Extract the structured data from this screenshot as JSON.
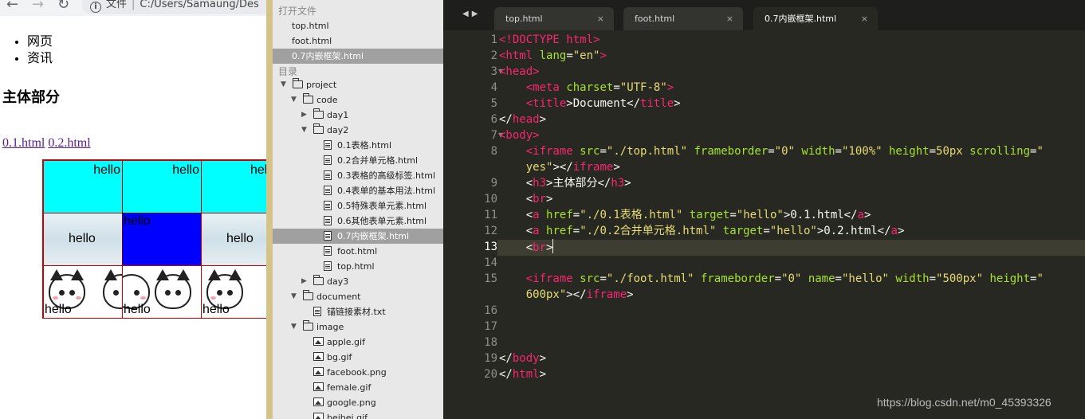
{
  "browser": {
    "url_label": "文件",
    "url_text": "C:/Users/Samaung/Des",
    "list_items": [
      "网页",
      "资讯"
    ],
    "heading": "主体部分",
    "links": [
      "0.1.html",
      "0.2.html"
    ],
    "cell_text": "hello"
  },
  "sidebar": {
    "open_files_header": "打开文件",
    "open_files": [
      "top.html",
      "foot.html",
      "0.7内嵌框架.html"
    ],
    "folders_header": "目录",
    "tree": [
      {
        "label": "project",
        "kind": "folder-open",
        "indent": 0
      },
      {
        "label": "code",
        "kind": "folder-open",
        "indent": 1
      },
      {
        "label": "day1",
        "kind": "folder",
        "indent": 2
      },
      {
        "label": "day2",
        "kind": "folder-open",
        "indent": 2
      },
      {
        "label": "0.1表格.html",
        "kind": "file",
        "indent": 3
      },
      {
        "label": "0.2合并单元格.html",
        "kind": "file",
        "indent": 3
      },
      {
        "label": "0.3表格的高级标签.html",
        "kind": "file",
        "indent": 3
      },
      {
        "label": "0.4表单的基本用法.html",
        "kind": "file",
        "indent": 3
      },
      {
        "label": "0.5特殊表单元素.html",
        "kind": "file",
        "indent": 3
      },
      {
        "label": "0.6其他表单元素.html",
        "kind": "file",
        "indent": 3
      },
      {
        "label": "0.7内嵌框架.html",
        "kind": "file",
        "indent": 3,
        "selected": true
      },
      {
        "label": "foot.html",
        "kind": "file",
        "indent": 3
      },
      {
        "label": "top.html",
        "kind": "file",
        "indent": 3
      },
      {
        "label": "day3",
        "kind": "folder",
        "indent": 2
      },
      {
        "label": "document",
        "kind": "folder-open",
        "indent": 1
      },
      {
        "label": "锚链接素材.txt",
        "kind": "file",
        "indent": 2
      },
      {
        "label": "image",
        "kind": "folder-open",
        "indent": 1
      },
      {
        "label": "apple.gif",
        "kind": "image",
        "indent": 2
      },
      {
        "label": "bg.gif",
        "kind": "image",
        "indent": 2
      },
      {
        "label": "facebook.png",
        "kind": "image",
        "indent": 2
      },
      {
        "label": "female.gif",
        "kind": "image",
        "indent": 2
      },
      {
        "label": "google.png",
        "kind": "image",
        "indent": 2
      },
      {
        "label": "beibei.gif",
        "kind": "image",
        "indent": 2
      }
    ]
  },
  "editor": {
    "tabs": [
      {
        "label": "top.html",
        "active": false
      },
      {
        "label": "foot.html",
        "active": false
      },
      {
        "label": "0.7内嵌框架.html",
        "active": true
      }
    ],
    "line_numbers": [
      "1",
      "2",
      "3",
      "4",
      "5",
      "6",
      "7",
      "8",
      "",
      "9",
      "10",
      "11",
      "12",
      "13",
      "14",
      "15",
      "",
      "16",
      "17",
      "18",
      "19",
      "20"
    ],
    "current_line": "13",
    "code": [
      [
        [
          "t",
          "<!DOCTYPE html>"
        ]
      ],
      [
        [
          "t",
          "<html"
        ],
        [
          "w",
          " "
        ],
        [
          "a",
          "lang"
        ],
        [
          "w",
          "="
        ],
        [
          "s",
          "\"en\""
        ],
        [
          "t",
          ">"
        ]
      ],
      [
        [
          "t",
          "<head>"
        ]
      ],
      [
        [
          "w",
          "    "
        ],
        [
          "t",
          "<meta"
        ],
        [
          "w",
          " "
        ],
        [
          "a",
          "charset"
        ],
        [
          "w",
          "="
        ],
        [
          "s",
          "\"UTF-8\""
        ],
        [
          "t",
          ">"
        ]
      ],
      [
        [
          "w",
          "    "
        ],
        [
          "t",
          "<title"
        ],
        [
          "w",
          ">Document</"
        ],
        [
          "t",
          "title"
        ],
        [
          "w",
          ">"
        ]
      ],
      [
        [
          "w",
          "</"
        ],
        [
          "t",
          "head"
        ],
        [
          "w",
          ">"
        ]
      ],
      [
        [
          "t",
          "<body>"
        ]
      ],
      [
        [
          "w",
          "    "
        ],
        [
          "t",
          "<iframe"
        ],
        [
          "w",
          " "
        ],
        [
          "a",
          "src"
        ],
        [
          "w",
          "="
        ],
        [
          "s",
          "\"./top.html\""
        ],
        [
          "w",
          " "
        ],
        [
          "a",
          "frameborder"
        ],
        [
          "w",
          "="
        ],
        [
          "s",
          "\"0\""
        ],
        [
          "w",
          " "
        ],
        [
          "a",
          "width"
        ],
        [
          "w",
          "="
        ],
        [
          "s",
          "\"100%\""
        ],
        [
          "w",
          " "
        ],
        [
          "a",
          "height"
        ],
        [
          "w",
          "="
        ],
        [
          "s",
          "50px"
        ],
        [
          "w",
          " "
        ],
        [
          "a",
          "scrolling"
        ],
        [
          "w",
          "="
        ],
        [
          "s",
          "\""
        ]
      ],
      [
        [
          "s",
          "    yes\""
        ],
        [
          "w",
          "></"
        ],
        [
          "t",
          "iframe"
        ],
        [
          "w",
          ">"
        ]
      ],
      [
        [
          "w",
          "    <"
        ],
        [
          "t",
          "h3"
        ],
        [
          "w",
          ">主体部分</"
        ],
        [
          "t",
          "h3"
        ],
        [
          "w",
          ">"
        ]
      ],
      [
        [
          "w",
          "    <"
        ],
        [
          "t",
          "br"
        ],
        [
          "w",
          ">"
        ]
      ],
      [
        [
          "w",
          "    <"
        ],
        [
          "t",
          "a"
        ],
        [
          "w",
          " "
        ],
        [
          "a",
          "href"
        ],
        [
          "w",
          "="
        ],
        [
          "s",
          "\"./0.1表格.html\""
        ],
        [
          "w",
          " "
        ],
        [
          "a",
          "target"
        ],
        [
          "w",
          "="
        ],
        [
          "s",
          "\"hello\""
        ],
        [
          "w",
          ">0.1.html</"
        ],
        [
          "t",
          "a"
        ],
        [
          "w",
          ">"
        ]
      ],
      [
        [
          "w",
          "    <"
        ],
        [
          "t",
          "a"
        ],
        [
          "w",
          " "
        ],
        [
          "a",
          "href"
        ],
        [
          "w",
          "="
        ],
        [
          "s",
          "\"./0.2合并单元格.html\""
        ],
        [
          "w",
          " "
        ],
        [
          "a",
          "target"
        ],
        [
          "w",
          "="
        ],
        [
          "s",
          "\"hello\""
        ],
        [
          "w",
          ">0.2.html</"
        ],
        [
          "t",
          "a"
        ],
        [
          "w",
          ">"
        ]
      ],
      [
        [
          "w",
          "    <"
        ],
        [
          "t",
          "br"
        ],
        [
          "w",
          ">"
        ]
      ],
      [],
      [
        [
          "w",
          "    "
        ],
        [
          "t",
          "<iframe"
        ],
        [
          "w",
          " "
        ],
        [
          "a",
          "src"
        ],
        [
          "w",
          "="
        ],
        [
          "s",
          "\"./foot.html\""
        ],
        [
          "w",
          " "
        ],
        [
          "a",
          "frameborder"
        ],
        [
          "w",
          "="
        ],
        [
          "s",
          "\"0\""
        ],
        [
          "w",
          " "
        ],
        [
          "a",
          "name"
        ],
        [
          "w",
          "="
        ],
        [
          "s",
          "\"hello\""
        ],
        [
          "w",
          " "
        ],
        [
          "a",
          "width"
        ],
        [
          "w",
          "="
        ],
        [
          "s",
          "\"500px\""
        ],
        [
          "w",
          " "
        ],
        [
          "a",
          "height"
        ],
        [
          "w",
          "="
        ],
        [
          "s",
          "\""
        ]
      ],
      [
        [
          "s",
          "    600px\""
        ],
        [
          "w",
          "></"
        ],
        [
          "t",
          "iframe"
        ],
        [
          "w",
          ">"
        ]
      ],
      [],
      [],
      [],
      [
        [
          "w",
          "</"
        ],
        [
          "t",
          "body"
        ],
        [
          "w",
          ">"
        ]
      ],
      [
        [
          "w",
          "</"
        ],
        [
          "t",
          "html"
        ],
        [
          "w",
          ">"
        ]
      ]
    ]
  },
  "watermark": "https://blog.csdn.net/m0_45393326",
  "colors": {
    "editor_bg": "#272822",
    "tag": "#f92672",
    "attr": "#a6e22e",
    "string": "#e6db74",
    "cyan_cell": "#00ffff",
    "blue_cell": "#0000ff",
    "border_red": "#cc0000"
  }
}
